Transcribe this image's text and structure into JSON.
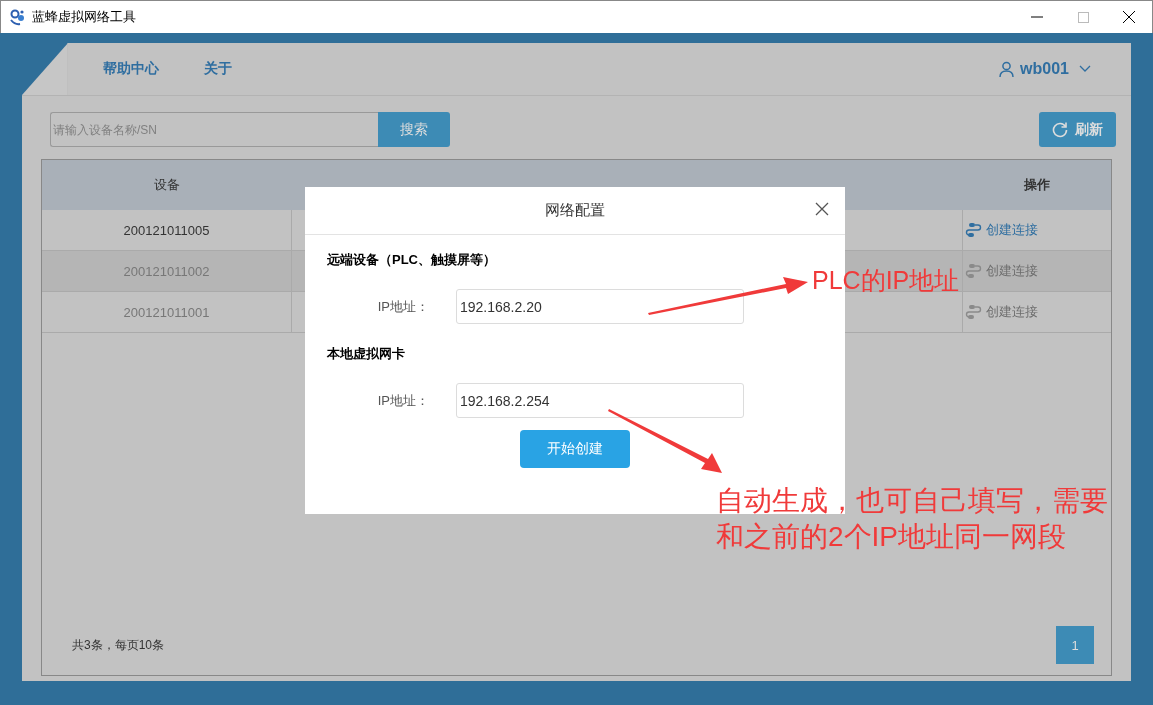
{
  "window": {
    "title": "蓝蜂虚拟网络工具"
  },
  "nav": {
    "items": [
      {
        "label": "帮助中心"
      },
      {
        "label": "关于"
      }
    ],
    "user": "wb001"
  },
  "search": {
    "placeholder": "请输入设备名称/SN",
    "button": "搜索"
  },
  "refresh_button": "刷新",
  "table": {
    "columns": [
      "设备",
      "操作"
    ],
    "rows": [
      {
        "device": "200121011005",
        "action": "创建连接",
        "disabled": false,
        "hovered": false
      },
      {
        "device": "200121011002",
        "action": "创建连接",
        "disabled": true,
        "hovered": true
      },
      {
        "device": "200121011001",
        "action": "创建连接",
        "disabled": true,
        "hovered": false
      }
    ]
  },
  "footer": {
    "summary": "共3条，每页10条",
    "pages": [
      {
        "label": "1",
        "selected": true
      }
    ]
  },
  "dialog": {
    "title": "网络配置",
    "sections": [
      {
        "heading": "远端设备（PLC、触摸屏等）",
        "field_label": "IP地址：",
        "value": "192.168.2.20"
      },
      {
        "heading": "本地虚拟网卡",
        "field_label": "IP地址：",
        "value": "192.168.2.254"
      }
    ],
    "submit": "开始创建"
  },
  "annotations": [
    {
      "text": "PLC的IP地址"
    },
    {
      "text": "自动生成，也可自己填写，需要和之前的2个IP地址同一网段"
    }
  ]
}
